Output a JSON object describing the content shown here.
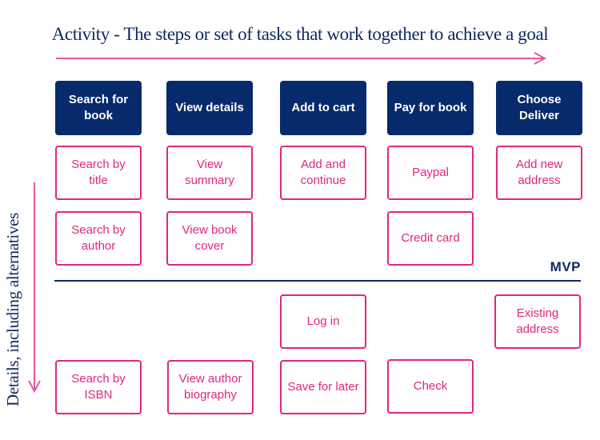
{
  "title": "Activity - The steps or set of tasks that work together to achieve a goal",
  "vertical_label": "Details, including alternatives",
  "mvp_label": "MVP",
  "colors": {
    "navy": "#062a6b",
    "pink": "#e0277f",
    "text_navy": "#0d2b63"
  },
  "activities": [
    {
      "label": "Search for book"
    },
    {
      "label": "View details"
    },
    {
      "label": "Add to cart"
    },
    {
      "label": "Pay for book"
    },
    {
      "label": "Choose Deliver"
    }
  ],
  "details": {
    "row1": [
      "Search by title",
      "View summary",
      "Add and continue",
      "Paypal",
      "Add new address"
    ],
    "row2": [
      "Search by author",
      "View book cover",
      "Credit card"
    ],
    "row3": [
      "Log in",
      "Existing address"
    ],
    "row4": [
      "Search by ISBN",
      "View author biography",
      "Save for later",
      "Check"
    ]
  }
}
